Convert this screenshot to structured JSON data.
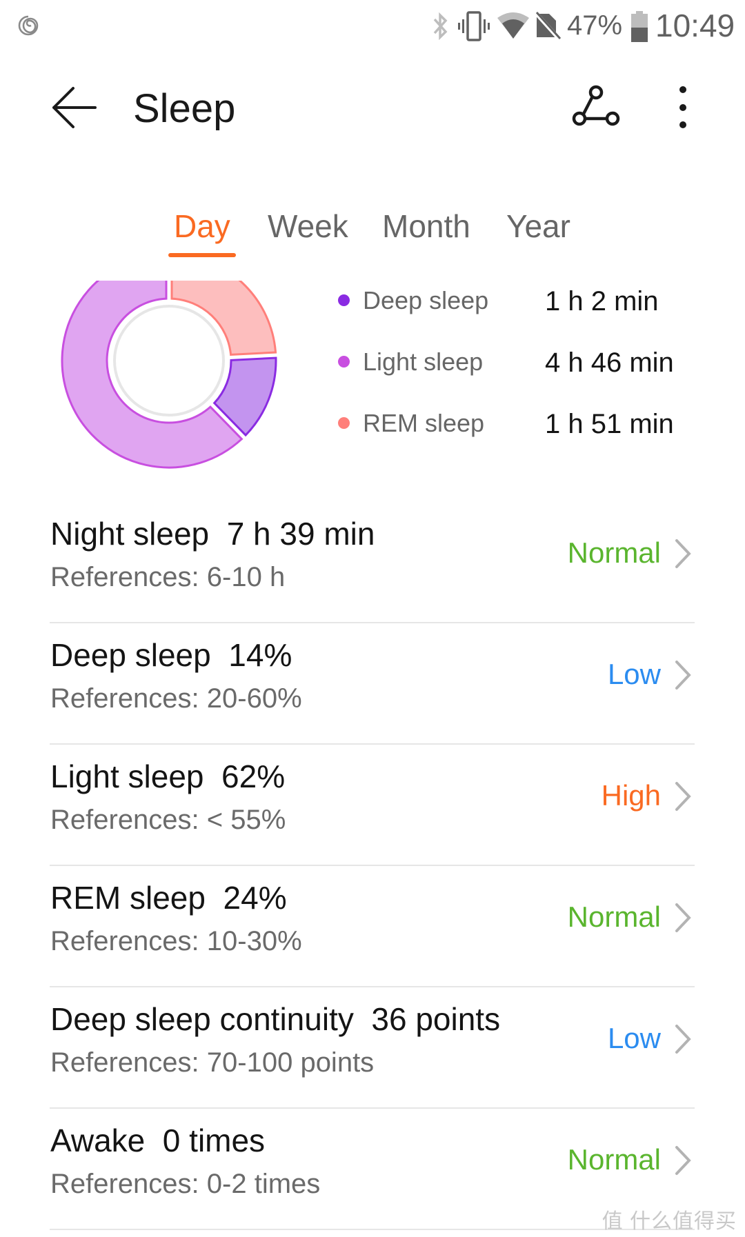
{
  "status_bar": {
    "battery_percent": "47%",
    "battery_level": 0.47,
    "time": "10:49",
    "icons": [
      "app-swirl-icon",
      "bluetooth-icon",
      "vibrate-icon",
      "wifi-icon",
      "no-sim-icon",
      "battery-icon"
    ]
  },
  "app_bar": {
    "title": "Sleep",
    "back_icon": "arrow-left-icon",
    "share_icon": "share-icon",
    "more_icon": "more-vertical-icon"
  },
  "tabs": [
    {
      "label": "Day",
      "active": true
    },
    {
      "label": "Week",
      "active": false
    },
    {
      "label": "Month",
      "active": false
    },
    {
      "label": "Year",
      "active": false
    }
  ],
  "colors": {
    "accent": "#fa6a22",
    "normal": "#5ab52e",
    "low": "#2b8cf0",
    "high": "#fa6a22",
    "deep_sleep": "#8a2be2",
    "light_sleep": "#c84fe0",
    "rem_sleep": "#ff7f7a"
  },
  "chart_data": {
    "type": "pie",
    "style": "donut",
    "start": "top",
    "direction": "clockwise",
    "series": [
      {
        "name": "REM sleep",
        "value_min": 111,
        "display": "1 h 51 min",
        "percent": 24,
        "fill": "#fdbebe",
        "stroke": "#ff7f7a"
      },
      {
        "name": "Deep sleep",
        "value_min": 62,
        "display": "1 h 2 min",
        "percent": 14,
        "fill": "#c394ef",
        "stroke": "#8a2be2"
      },
      {
        "name": "Light sleep",
        "value_min": 286,
        "display": "4 h 46 min",
        "percent": 62,
        "fill": "#e0a5f1",
        "stroke": "#c84fe0"
      }
    ]
  },
  "legend": [
    {
      "label": "Deep sleep",
      "value": "1 h 2 min",
      "color": "#8a2be2"
    },
    {
      "label": "Light sleep",
      "value": "4 h 46 min",
      "color": "#c84fe0"
    },
    {
      "label": "REM sleep",
      "value": "1 h 51 min",
      "color": "#ff7f7a"
    }
  ],
  "metrics": [
    {
      "title": "Night sleep  7 h 39 min",
      "reference": "References: 6-10 h",
      "status": "Normal",
      "status_color": "#5ab52e"
    },
    {
      "title": "Deep sleep  14%",
      "reference": "References: 20-60%",
      "status": "Low",
      "status_color": "#2b8cf0"
    },
    {
      "title": "Light sleep  62%",
      "reference": "References: < 55%",
      "status": "High",
      "status_color": "#fa6a22"
    },
    {
      "title": "REM sleep  24%",
      "reference": "References: 10-30%",
      "status": "Normal",
      "status_color": "#5ab52e"
    },
    {
      "title": "Deep sleep continuity  36 points",
      "reference": "References: 70-100 points",
      "status": "Low",
      "status_color": "#2b8cf0"
    },
    {
      "title": "Awake  0 times",
      "reference": "References: 0-2 times",
      "status": "Normal",
      "status_color": "#5ab52e"
    }
  ],
  "watermark": "值 什么值得买"
}
